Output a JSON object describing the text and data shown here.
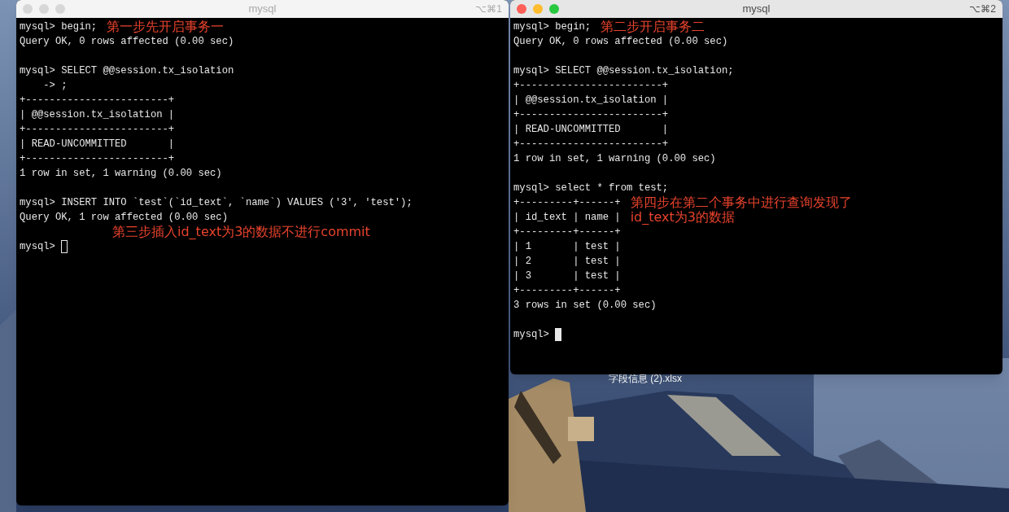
{
  "desktop": {
    "file_label": "字段信息 (2).xlsx"
  },
  "windows": [
    {
      "title": "mysql",
      "shortcut": "⌥⌘1",
      "active": false,
      "lines": [
        {
          "text": "mysql> begin;",
          "note": "第一步先开启事务一"
        },
        {
          "text": "Query OK, 0 rows affected (0.00 sec)"
        },
        {
          "text": "mysql> SELECT @@session.tx_isolation",
          "blank_before": true
        },
        {
          "text": "    -> ;"
        },
        {
          "text": "+------------------------+"
        },
        {
          "text": "| @@session.tx_isolation |"
        },
        {
          "text": "+------------------------+"
        },
        {
          "text": "| READ-UNCOMMITTED       |"
        },
        {
          "text": "+------------------------+"
        },
        {
          "text": "1 row in set, 1 warning (0.00 sec)"
        },
        {
          "text": "mysql> INSERT INTO `test`(`id_text`, `name`) VALUES ('3', 'test');",
          "blank_before": true
        },
        {
          "text": "Query OK, 1 row affected (0.00 sec)"
        },
        {
          "note": "第三步插入id_text为3的数据不进行commit"
        },
        {
          "text": "mysql> ",
          "cursor": true
        }
      ]
    },
    {
      "title": "mysql",
      "shortcut": "⌥⌘2",
      "active": true,
      "lines": [
        {
          "text": "mysql> begin;",
          "note": "第二步开启事务二"
        },
        {
          "text": "Query OK, 0 rows affected (0.00 sec)"
        },
        {
          "text": "mysql> SELECT @@session.tx_isolation;",
          "blank_before": true
        },
        {
          "text": "+------------------------+"
        },
        {
          "text": "| @@session.tx_isolation |"
        },
        {
          "text": "+------------------------+"
        },
        {
          "text": "| READ-UNCOMMITTED       |"
        },
        {
          "text": "+------------------------+"
        },
        {
          "text": "1 row in set, 1 warning (0.00 sec)"
        },
        {
          "text": "mysql> select * from test;",
          "blank_before": true
        },
        {
          "text": "+---------+------+",
          "note": "第四步在第二个事务中进行查询发现了"
        },
        {
          "text": "| id_text | name |",
          "note": "id_text为3的数据"
        },
        {
          "text": "+---------+------+"
        },
        {
          "text": "| 1       | test |"
        },
        {
          "text": "| 2       | test |"
        },
        {
          "text": "| 3       | test |"
        },
        {
          "text": "+---------+------+"
        },
        {
          "text": "3 rows in set (0.00 sec)"
        },
        {
          "text": "mysql> ",
          "cursor": true,
          "blank_before": true
        }
      ]
    }
  ]
}
